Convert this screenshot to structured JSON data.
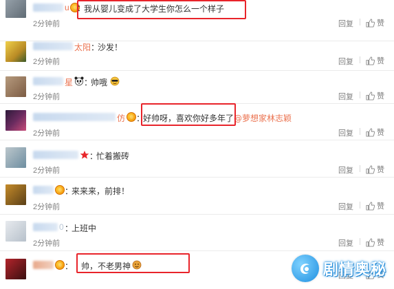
{
  "comments": [
    {
      "username": "u",
      "text": "我从婴儿变成了大学生你怎么一个样子",
      "time": "2分钟前",
      "reply_label": "回复",
      "like_label": "赞"
    },
    {
      "username": "太阳",
      "text": "沙发！",
      "time": "2分钟前",
      "reply_label": "回复",
      "like_label": "赞"
    },
    {
      "username": "星",
      "text": "帅哦",
      "time": "2分钟前",
      "reply_label": "回复",
      "like_label": "赞"
    },
    {
      "username": "仿",
      "text": "好帅呀，喜欢你好多年了",
      "mention": "@萝想家林志颖",
      "time": "2分钟前",
      "reply_label": "回复",
      "like_label": "赞"
    },
    {
      "text": "忙着搬砖",
      "time": "2分钟前",
      "reply_label": "回复",
      "like_label": "赞"
    },
    {
      "text": "来来来，前排！",
      "time": "2分钟前",
      "reply_label": "回复",
      "like_label": "赞"
    },
    {
      "username": "0",
      "text": "上班中",
      "time": "2分钟前",
      "reply_label": "回复",
      "like_label": "赞"
    },
    {
      "text": "帅，不老男神",
      "reply_label": "回复",
      "like_label": "赞"
    }
  ],
  "colon": "：",
  "watermark": {
    "text": "剧情奥秘"
  },
  "colors": {
    "highlight": "#e8232a",
    "username": "#eb7350",
    "meta": "#808080"
  }
}
